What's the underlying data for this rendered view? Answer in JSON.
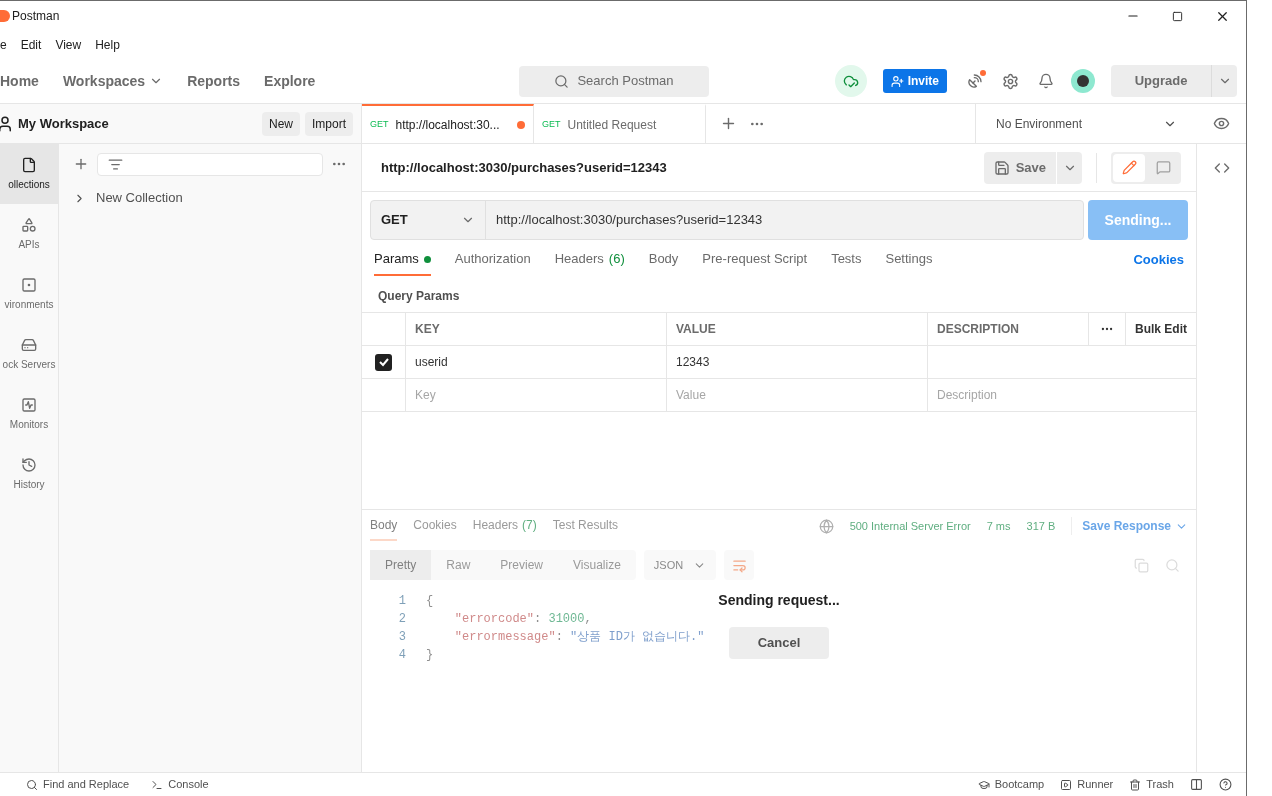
{
  "window": {
    "title": "Postman"
  },
  "menu": [
    "e",
    "Edit",
    "View",
    "Help"
  ],
  "nav": [
    {
      "label": "Home",
      "dropdown": false
    },
    {
      "label": "Workspaces",
      "dropdown": true
    },
    {
      "label": "Reports",
      "dropdown": false
    },
    {
      "label": "Explore",
      "dropdown": false
    }
  ],
  "search": {
    "placeholder": "Search Postman"
  },
  "invite": "Invite",
  "upgrade": "Upgrade",
  "workspace": {
    "name": "My Workspace",
    "buttons": [
      "New",
      "Import"
    ]
  },
  "sidebar": {
    "items": [
      {
        "label": "ollections",
        "selected": true
      },
      {
        "label": "APIs",
        "selected": false
      },
      {
        "label": "vironments",
        "selected": false
      },
      {
        "label": "ock Servers",
        "selected": false
      },
      {
        "label": "Monitors",
        "selected": false
      },
      {
        "label": "History",
        "selected": false
      }
    ]
  },
  "collections": [
    {
      "label": "New Collection",
      "expanded": false
    }
  ],
  "tabs": [
    {
      "method": "GET",
      "label": "http://localhost:30...",
      "selected": true,
      "unsaved": true
    },
    {
      "method": "GET",
      "label": "Untitled Request",
      "selected": false,
      "unsaved": false
    }
  ],
  "environment": "No Environment",
  "request": {
    "title": "http://localhost:3030/purchases?userid=12343",
    "save": "Save",
    "method": "GET",
    "url": "http://localhost:3030/purchases?userid=12343",
    "send": "Sending..."
  },
  "request_tabs": [
    {
      "label": "Params",
      "dot": true,
      "selected": true
    },
    {
      "label": "Authorization",
      "dot": false,
      "selected": false
    },
    {
      "label": "Headers",
      "count": "(6)",
      "dot": false,
      "selected": false
    },
    {
      "label": "Body",
      "dot": false,
      "selected": false
    },
    {
      "label": "Pre-request Script",
      "dot": false,
      "selected": false
    },
    {
      "label": "Tests",
      "dot": false,
      "selected": false
    },
    {
      "label": "Settings",
      "dot": false,
      "selected": false
    }
  ],
  "cookies": "Cookies",
  "query_params": {
    "title": "Query Params",
    "columns": [
      "KEY",
      "VALUE",
      "DESCRIPTION"
    ],
    "bulk_edit": "Bulk Edit",
    "rows": [
      {
        "checked": true,
        "key": "userid",
        "value": "12343"
      }
    ],
    "new_row": {
      "key": "Key",
      "value": "Value",
      "description": "Description"
    }
  },
  "response": {
    "tabs": [
      {
        "label": "Body",
        "selected": true
      },
      {
        "label": "Cookies",
        "selected": false
      },
      {
        "label": "Headers",
        "count": "(7)",
        "selected": false
      },
      {
        "label": "Test Results",
        "selected": false
      }
    ],
    "status": "500 Internal Server Error",
    "time": "7 ms",
    "size": "317 B",
    "save": "Save Response",
    "views": [
      {
        "label": "Pretty",
        "selected": true
      },
      {
        "label": "Raw",
        "selected": false
      },
      {
        "label": "Preview",
        "selected": false
      },
      {
        "label": "Visualize",
        "selected": false
      }
    ],
    "format": "JSON",
    "lines": [
      {
        "number": "1",
        "parts": [
          {
            "kind": "punct",
            "text": "{"
          }
        ]
      },
      {
        "number": "2",
        "parts": [
          {
            "kind": "key",
            "text": "    \"errorcode\""
          },
          {
            "kind": "punct",
            "text": ": "
          },
          {
            "kind": "number",
            "text": "31000"
          },
          {
            "kind": "punct",
            "text": ","
          }
        ]
      },
      {
        "number": "3",
        "parts": [
          {
            "kind": "key",
            "text": "    \"errormessage\""
          },
          {
            "kind": "punct",
            "text": ": "
          },
          {
            "kind": "string",
            "text": "\"상품 ID가 없습니다.\""
          }
        ]
      },
      {
        "number": "4",
        "parts": [
          {
            "kind": "punct",
            "text": "}"
          }
        ]
      }
    ]
  },
  "overlay": {
    "message": "Sending request...",
    "cancel": "Cancel"
  },
  "status_bar": {
    "left": [
      "Find and Replace",
      "Console"
    ],
    "right": [
      "Bootcamp",
      "Runner",
      "Trash"
    ]
  }
}
